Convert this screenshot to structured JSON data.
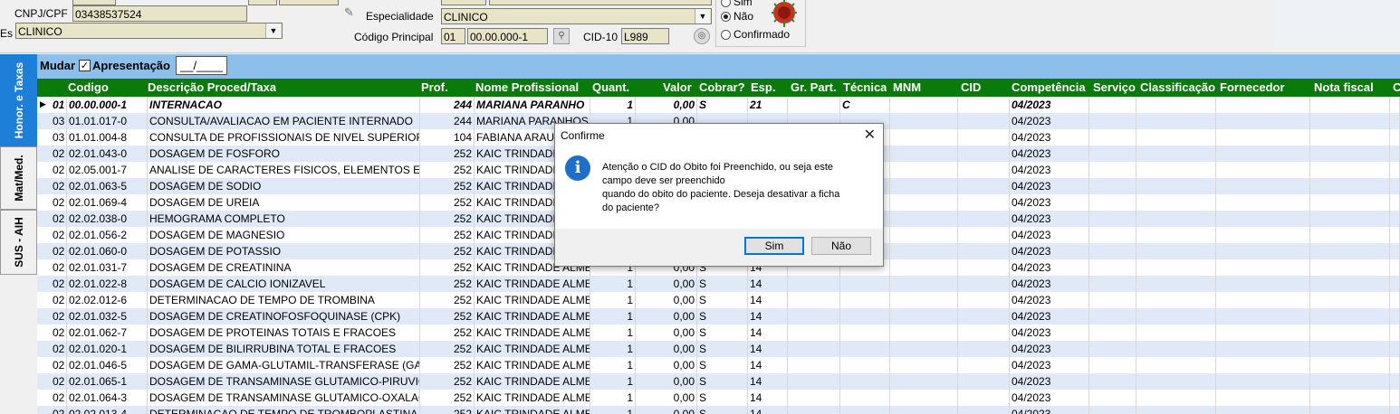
{
  "form": {
    "cnpj_label": "CNPJ/CPF",
    "cnpj_value": "03438537524",
    "esp_left_label": "Es",
    "esp_left_value": "CLINICO",
    "especialidade_label": "Especialidade",
    "especialidade_value": "CLINICO",
    "codigo_principal_label": "Código Principal",
    "codigo_principal_prefix": "01",
    "codigo_principal_value": "00.00.000-1",
    "cid10_label": "CID-10",
    "cid10_value": "L989",
    "radios": [
      "Sim",
      "Não",
      "Confirmado"
    ],
    "radio_selected": "Não"
  },
  "tabs": [
    "Honor. e Taxas",
    "Mat/Med.",
    "SUS - AIH"
  ],
  "toolbar": {
    "mudar": "Mudar",
    "apresentacao": "Apresentação",
    "date_value": "__/____"
  },
  "grid": {
    "columns": [
      "Codigo",
      "Descrição Proced/Taxa",
      "Prof.",
      "Nome Profissional",
      "Quant.",
      "Valor",
      "Cobrar?",
      "Esp.",
      "Gr. Part.",
      "Técnica",
      "MNM",
      "CID",
      "Competência",
      "Serviço",
      "Classificação",
      "Fornecedor",
      "Nota fiscal",
      "C"
    ],
    "rows": [
      {
        "grp": "01",
        "cod": "00.00.000-1",
        "desc": "INTERNACAO",
        "prof": "244",
        "nome": "MARIANA PARANHO",
        "quant": "1",
        "valor": "0,00",
        "cobrar": "S",
        "esp": "21",
        "tec": "C",
        "comp": "04/2023"
      },
      {
        "grp": "03",
        "cod": "01.01.017-0",
        "desc": "CONSULTA/AVALIACAO EM PACIENTE INTERNADO",
        "prof": "244",
        "nome": "MARIANA PARANHOS",
        "quant": "1",
        "valor": "0,00",
        "cobrar": "",
        "esp": "",
        "tec": "",
        "comp": "04/2023"
      },
      {
        "grp": "03",
        "cod": "01.01.004-8",
        "desc": "CONSULTA DE PROFISSIONAIS DE NIVEL SUPERIOR",
        "prof": "104",
        "nome": "FABIANA ARAUJO",
        "quant": "",
        "valor": "",
        "cobrar": "",
        "esp": "",
        "tec": "",
        "comp": "04/2023"
      },
      {
        "grp": "02",
        "cod": "02.01.043-0",
        "desc": "DOSAGEM DE FOSFORO",
        "prof": "252",
        "nome": "KAIC TRINDADE",
        "quant": "",
        "valor": "",
        "cobrar": "",
        "esp": "",
        "tec": "",
        "comp": "04/2023"
      },
      {
        "grp": "02",
        "cod": "02.05.001-7",
        "desc": "ANALISE DE CARACTERES FISICOS, ELEMENTOS E",
        "prof": "252",
        "nome": "KAIC TRINDADE",
        "quant": "",
        "valor": "",
        "cobrar": "",
        "esp": "",
        "tec": "",
        "comp": "04/2023"
      },
      {
        "grp": "02",
        "cod": "02.01.063-5",
        "desc": "DOSAGEM DE SODIO",
        "prof": "252",
        "nome": "KAIC TRINDADE",
        "quant": "",
        "valor": "",
        "cobrar": "",
        "esp": "",
        "tec": "",
        "comp": "04/2023"
      },
      {
        "grp": "02",
        "cod": "02.01.069-4",
        "desc": "DOSAGEM DE UREIA",
        "prof": "252",
        "nome": "KAIC TRINDADE",
        "quant": "",
        "valor": "",
        "cobrar": "",
        "esp": "",
        "tec": "",
        "comp": "04/2023"
      },
      {
        "grp": "02",
        "cod": "02.02.038-0",
        "desc": "HEMOGRAMA COMPLETO",
        "prof": "252",
        "nome": "KAIC TRINDADE",
        "quant": "",
        "valor": "",
        "cobrar": "",
        "esp": "",
        "tec": "",
        "comp": "04/2023"
      },
      {
        "grp": "02",
        "cod": "02.01.056-2",
        "desc": "DOSAGEM DE MAGNESIO",
        "prof": "252",
        "nome": "KAIC TRINDADE",
        "quant": "",
        "valor": "",
        "cobrar": "",
        "esp": "",
        "tec": "",
        "comp": "04/2023"
      },
      {
        "grp": "02",
        "cod": "02.01.060-0",
        "desc": "DOSAGEM DE POTASSIO",
        "prof": "252",
        "nome": "KAIC TRINDADE",
        "quant": "",
        "valor": "",
        "cobrar": "",
        "esp": "",
        "tec": "",
        "comp": "04/2023"
      },
      {
        "grp": "02",
        "cod": "02.01.031-7",
        "desc": "DOSAGEM DE CREATININA",
        "prof": "252",
        "nome": "KAIC TRINDADE ALME",
        "quant": "1",
        "valor": "0,00",
        "cobrar": "S",
        "esp": "14",
        "tec": "",
        "comp": "04/2023"
      },
      {
        "grp": "02",
        "cod": "02.01.022-8",
        "desc": "DOSAGEM DE CALCIO IONIZAVEL",
        "prof": "252",
        "nome": "KAIC TRINDADE ALME",
        "quant": "1",
        "valor": "0,00",
        "cobrar": "S",
        "esp": "14",
        "tec": "",
        "comp": "04/2023"
      },
      {
        "grp": "02",
        "cod": "02.02.012-6",
        "desc": "DETERMINACAO DE TEMPO DE TROMBINA",
        "prof": "252",
        "nome": "KAIC TRINDADE ALME",
        "quant": "1",
        "valor": "0,00",
        "cobrar": "S",
        "esp": "14",
        "tec": "",
        "comp": "04/2023"
      },
      {
        "grp": "02",
        "cod": "02.01.032-5",
        "desc": "DOSAGEM DE CREATINOFOSFOQUINASE (CPK)",
        "prof": "252",
        "nome": "KAIC TRINDADE ALME",
        "quant": "1",
        "valor": "0,00",
        "cobrar": "S",
        "esp": "14",
        "tec": "",
        "comp": "04/2023"
      },
      {
        "grp": "02",
        "cod": "02.01.062-7",
        "desc": "DOSAGEM DE PROTEINAS TOTAIS E FRACOES",
        "prof": "252",
        "nome": "KAIC TRINDADE ALME",
        "quant": "1",
        "valor": "0,00",
        "cobrar": "S",
        "esp": "14",
        "tec": "",
        "comp": "04/2023"
      },
      {
        "grp": "02",
        "cod": "02.01.020-1",
        "desc": "DOSAGEM DE BILIRRUBINA TOTAL E FRACOES",
        "prof": "252",
        "nome": "KAIC TRINDADE ALME",
        "quant": "1",
        "valor": "0,00",
        "cobrar": "S",
        "esp": "14",
        "tec": "",
        "comp": "04/2023"
      },
      {
        "grp": "02",
        "cod": "02.01.046-5",
        "desc": "DOSAGEM DE GAMA-GLUTAMIL-TRANSFERASE (GAM",
        "prof": "252",
        "nome": "KAIC TRINDADE ALME",
        "quant": "1",
        "valor": "0,00",
        "cobrar": "S",
        "esp": "14",
        "tec": "",
        "comp": "04/2023"
      },
      {
        "grp": "02",
        "cod": "02.01.065-1",
        "desc": "DOSAGEM DE TRANSAMINASE GLUTAMICO-PIRUVIC",
        "prof": "252",
        "nome": "KAIC TRINDADE ALME",
        "quant": "1",
        "valor": "0,00",
        "cobrar": "S",
        "esp": "14",
        "tec": "",
        "comp": "04/2023"
      },
      {
        "grp": "02",
        "cod": "02.01.064-3",
        "desc": "DOSAGEM DE TRANSAMINASE GLUTAMICO-OXALACI",
        "prof": "252",
        "nome": "KAIC TRINDADE ALME",
        "quant": "1",
        "valor": "0,00",
        "cobrar": "S",
        "esp": "14",
        "tec": "",
        "comp": "04/2023"
      },
      {
        "grp": "02",
        "cod": "02.02.013-4",
        "desc": "DETERMINACAO DE TEMPO DE TROMBOPLASTINA P",
        "prof": "252",
        "nome": "KAIC TRINDADE ALME",
        "quant": "1",
        "valor": "0,00",
        "cobrar": "S",
        "esp": "14",
        "tec": "",
        "comp": "04/2023"
      }
    ]
  },
  "dialog": {
    "title": "Confirme",
    "message": "Atenção o CID do Obito foi Preenchido, ou seja este\ncampo deve ser preenchido\nquando do obito do paciente. Deseja desativar a ficha\ndo paciente?",
    "yes": "Sim",
    "no": "Não"
  }
}
